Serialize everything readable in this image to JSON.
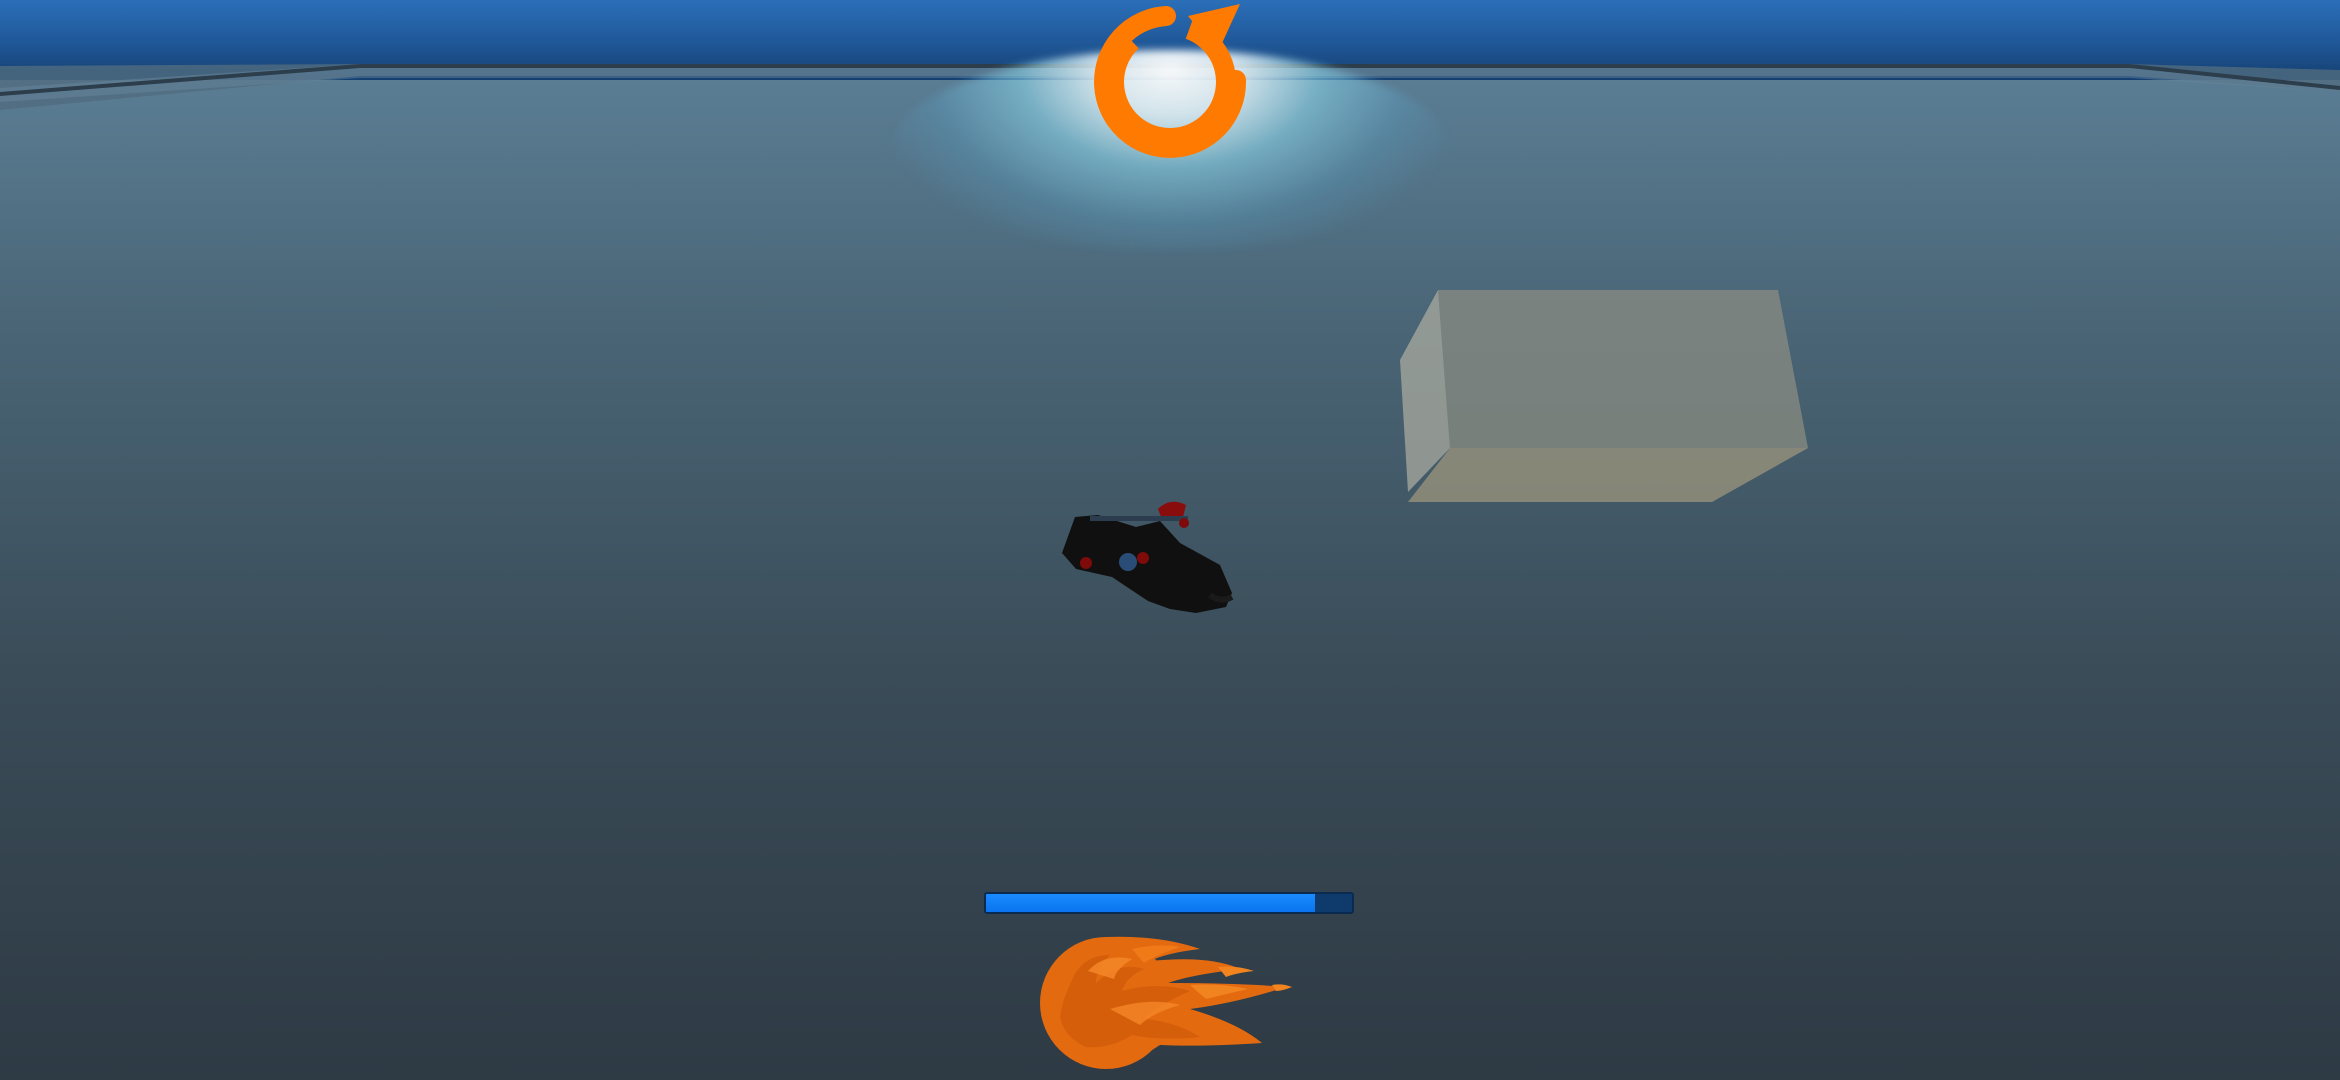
{
  "colors": {
    "sky": "#1f5797",
    "floor": "#3a4d5a",
    "accent_orange": "#ff7a00",
    "boost_fill": "#0a78f5",
    "boost_track": "#0e3a6c",
    "crate": "#8f8e80"
  },
  "hud": {
    "restart_icon": "restart-icon",
    "boost_icon": "fireball-icon",
    "boost_level_fraction": 0.9
  },
  "scene": {
    "vehicle_icon": "vehicle",
    "obstacle_icon": "crate"
  }
}
